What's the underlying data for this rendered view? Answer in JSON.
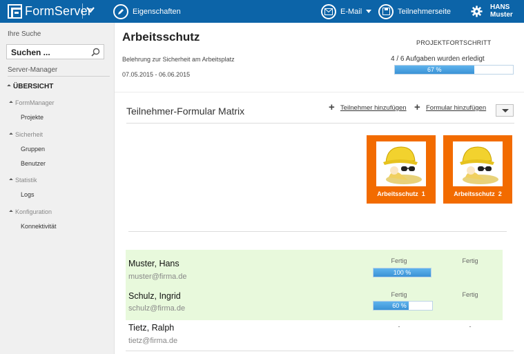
{
  "app": {
    "name": "FormServer",
    "toolbar": {
      "properties_label": "Eigenschaften",
      "email_label": "E-Mail",
      "participant_page_label": "Teilnehmerseite"
    },
    "user": {
      "first": "HANS",
      "last": "Muster"
    }
  },
  "sidebar": {
    "search_label": "Ihre Suche",
    "search_placeholder": "Suchen ...",
    "server_manager_label": "Server-Manager",
    "overview_label": "ÜBERSICHT",
    "groups": [
      {
        "label": "FormManager",
        "items": [
          "Projekte"
        ]
      },
      {
        "label": "Sicherheit",
        "items": [
          "Gruppen",
          "Benutzer"
        ]
      },
      {
        "label": "Statistik",
        "items": [
          "Logs"
        ]
      },
      {
        "label": "Konfiguration",
        "items": [
          "Konnektivität"
        ]
      }
    ]
  },
  "project": {
    "title": "Arbeitsschutz",
    "subtitle": "Belehrung zur Sicherheit am Arbeitsplatz",
    "dates": "07.05.2015 - 06.06.2015",
    "progress_label": "PROJEKTFORTSCHRITT",
    "tasks_done": "4 / 6 Aufgaben wurden erledigt",
    "progress_text": "67 %",
    "progress_value": 0.67
  },
  "matrix": {
    "title": "Teilnehmer-Formular Matrix",
    "add_participant": "Teilnehmer hinzufügen",
    "add_form": "Formular hinzufügen",
    "forms": [
      {
        "label": "Arbeitsschutz",
        "num": "1"
      },
      {
        "label": "Arbeitsschutz",
        "num": "2"
      }
    ],
    "participants": [
      {
        "name": "Muster, Hans",
        "email": "muster@firma.de",
        "status1": "Fertig",
        "progress_text": "100 %",
        "progress_value": 1.0,
        "status2": "Fertig"
      },
      {
        "name": "Schulz, Ingrid",
        "email": "schulz@firma.de",
        "status1": "Fertig",
        "progress_text": "60 %",
        "progress_value": 0.6,
        "status2": "Fertig"
      },
      {
        "name": "Tietz, Ralph",
        "email": "tietz@firma.de",
        "status1": "-",
        "status2": "-"
      }
    ]
  },
  "colors": {
    "topbar": "#0c64a8",
    "card": "#f26b00",
    "row_highlight": "#e8f9dc",
    "progress": "#3a92d6"
  }
}
